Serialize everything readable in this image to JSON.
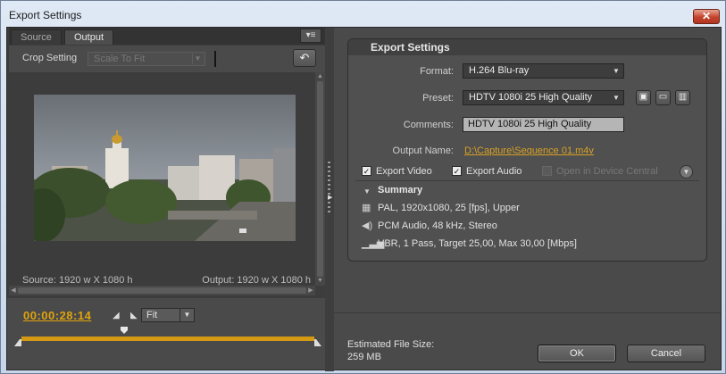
{
  "window": {
    "title": "Export Settings",
    "close_glyph": "✕"
  },
  "left": {
    "tabs": [
      {
        "label": "Source"
      },
      {
        "label": "Output"
      }
    ],
    "active_tab": "Output",
    "crop": {
      "label": "Crop Setting",
      "value": "Scale To Fit"
    },
    "source_info": "Source: 1920 w X 1080 h",
    "output_info": "Output: 1920 w X 1080 h",
    "timecode": "00:00:28:14",
    "zoom": "Fit"
  },
  "settings": {
    "header": "Export Settings",
    "format_label": "Format:",
    "format_value": "H.264 Blu-ray",
    "preset_label": "Preset:",
    "preset_value": "HDTV 1080i 25 High Quality",
    "comments_label": "Comments:",
    "comments_value": "HDTV 1080i 25 High Quality",
    "output_label": "Output Name:",
    "output_value": "D:\\Capture\\Sequence 01.m4v",
    "export_video": {
      "label": "Export Video",
      "checked": true
    },
    "export_audio": {
      "label": "Export Audio",
      "checked": true
    },
    "device_central": {
      "label": "Open in Device Central",
      "checked": false,
      "enabled": false
    },
    "summary_title": "Summary",
    "summary": [
      {
        "icon": "film-icon",
        "text": "PAL, 1920x1080, 25 [fps], Upper"
      },
      {
        "icon": "speaker-icon",
        "text": "PCM Audio, 48 kHz, Stereo"
      },
      {
        "icon": "bitrate-icon",
        "text": "VBR, 1 Pass, Target 25,00, Max 30,00 [Mbps]"
      }
    ]
  },
  "footer": {
    "est_label": "Estimated File Size:",
    "est_value": "259 MB",
    "ok": "OK",
    "cancel": "Cancel"
  },
  "colors": {
    "accent": "#d59a13",
    "panel": "#4a4a4a",
    "link": "#d8a224"
  }
}
